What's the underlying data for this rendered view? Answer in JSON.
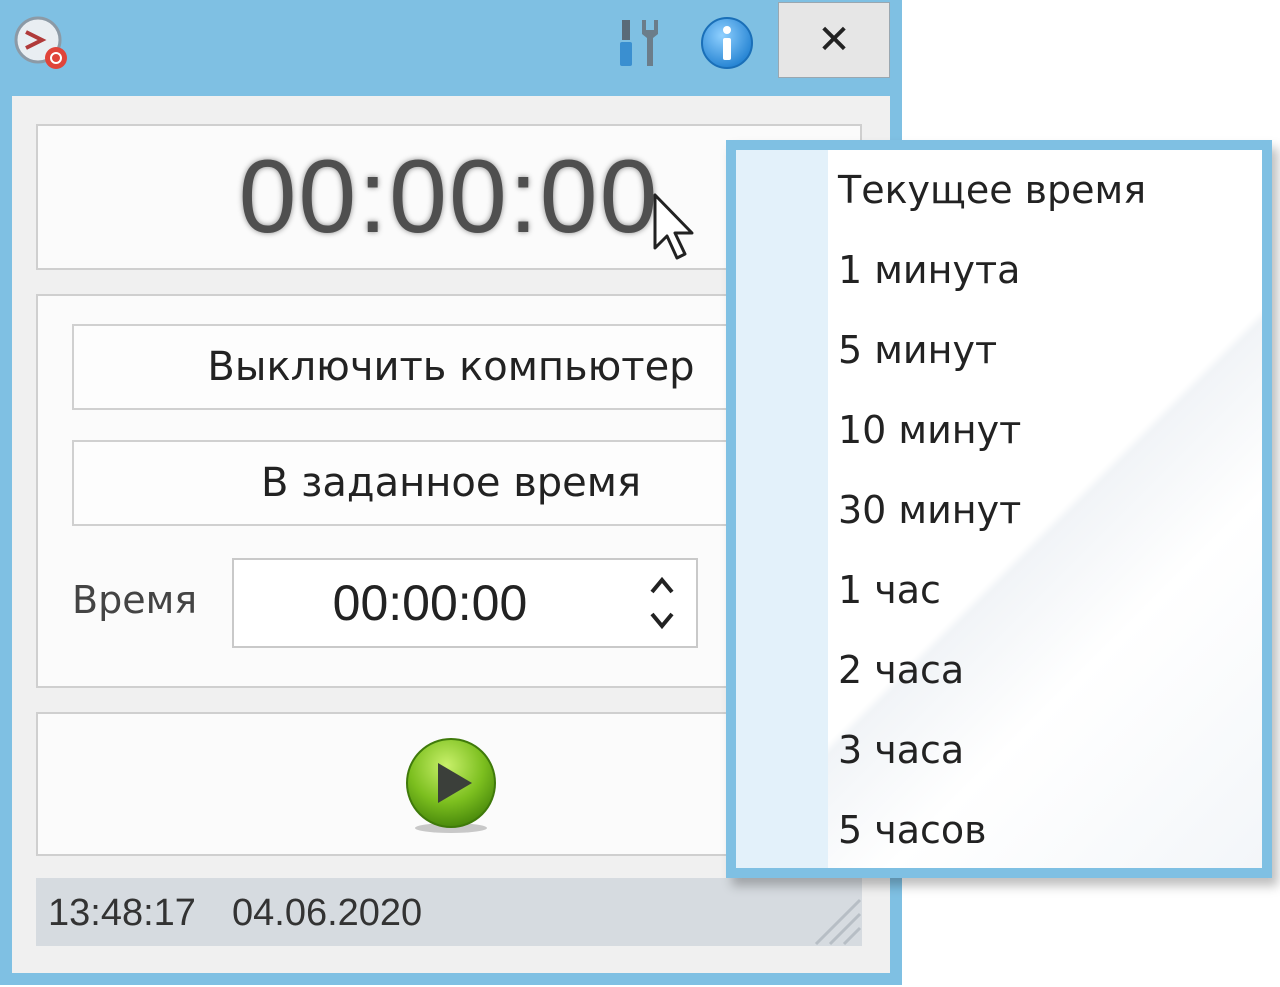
{
  "window": {
    "close_label": "✕"
  },
  "display": {
    "countdown": "00:00:00"
  },
  "controls": {
    "action_button": "Выключить компьютер",
    "mode_button": "В заданное время",
    "time_label": "Время",
    "time_value": "00:00:00"
  },
  "statusbar": {
    "time": "13:48:17",
    "date": "04.06.2020"
  },
  "dropdown": {
    "items": [
      {
        "label": "Текущее время"
      },
      {
        "label": "1 минута"
      },
      {
        "label": "5 минут"
      },
      {
        "label": "10 минут"
      },
      {
        "label": "30 минут"
      },
      {
        "label": "1 час"
      },
      {
        "label": "2 часа"
      },
      {
        "label": "3 часа"
      },
      {
        "label": "5 часов"
      }
    ]
  },
  "colors": {
    "frame": "#7fc0e3",
    "play_green": "#7cbf1f",
    "info_blue": "#2e8fd9"
  },
  "icons": [
    "app-shutdown-icon",
    "tools-icon",
    "info-icon",
    "close-icon",
    "chevron-up-icon",
    "chevron-down-icon",
    "play-icon",
    "mouse-cursor-icon",
    "resize-grip-icon"
  ]
}
